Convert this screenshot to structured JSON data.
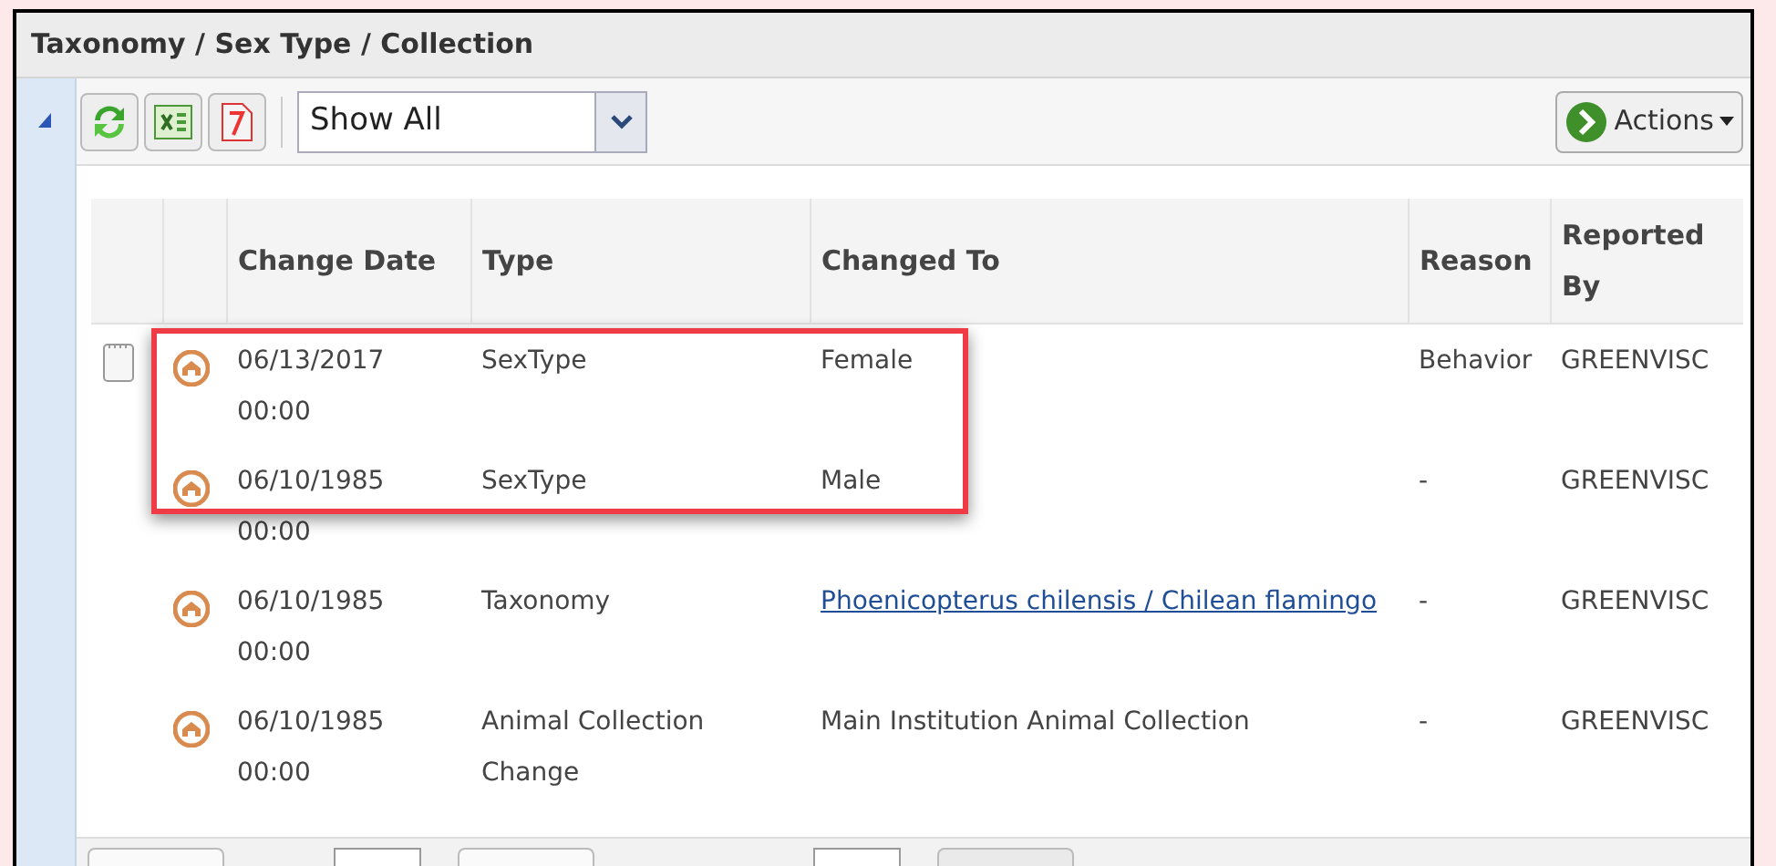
{
  "panel": {
    "title": "Taxonomy / Sex Type / Collection",
    "expanded": true
  },
  "toolbar": {
    "filter": "Show All",
    "actions_label": "Actions"
  },
  "table": {
    "columns": [
      "Change Date",
      "Type",
      "Changed To",
      "Reason",
      "Reported By"
    ],
    "rows": [
      {
        "has_note": true,
        "date": "06/13/2017",
        "time": "00:00",
        "type": "SexType",
        "changed_to": "Female",
        "link": false,
        "reason": "Behavior",
        "reported_by": "GREENVISC"
      },
      {
        "has_note": false,
        "date": "06/10/1985",
        "time": "00:00",
        "type": "SexType",
        "changed_to": "Male",
        "link": false,
        "reason": "-",
        "reported_by": "GREENVISC"
      },
      {
        "has_note": false,
        "date": "06/10/1985",
        "time": "00:00",
        "type": "Taxonomy",
        "changed_to": "Phoenicopterus chilensis / Chilean flamingo",
        "link": true,
        "reason": "-",
        "reported_by": "GREENVISC"
      },
      {
        "has_note": false,
        "date": "06/10/1985",
        "time": "00:00",
        "type": "Animal Collection Change",
        "changed_to": "Main Institution Animal Collection",
        "link": false,
        "reason": "-",
        "reported_by": "GREENVISC"
      }
    ]
  },
  "highlight": {
    "shown": true
  }
}
